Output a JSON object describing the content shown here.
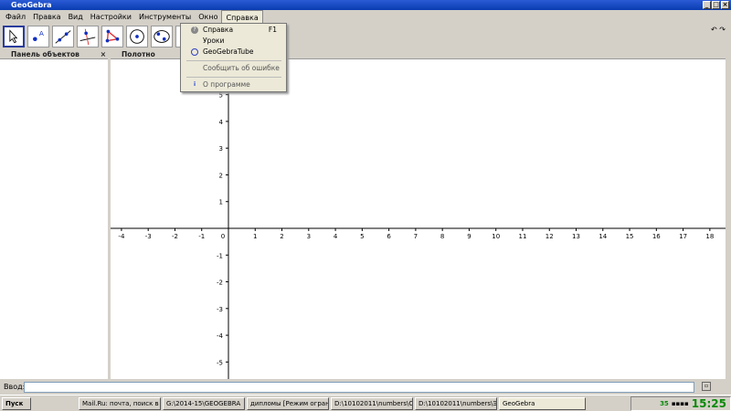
{
  "window": {
    "title": "GeoGebra"
  },
  "menubar": [
    "Файл",
    "Правка",
    "Вид",
    "Настройки",
    "Инструменты",
    "Окно",
    "Справка"
  ],
  "help_menu": {
    "items": [
      {
        "label": "Справка",
        "shortcut": "F1",
        "icon": "help-icon"
      },
      {
        "label": "Уроки"
      },
      {
        "label": "GeoGebraTube",
        "icon": "geogebra-icon"
      },
      {
        "label": "Сообщить об ошибке"
      },
      {
        "label": "О программе",
        "icon": "info-icon"
      }
    ]
  },
  "panels": {
    "algebra": "Панель объектов",
    "graphics": "Полотно"
  },
  "axes": {
    "x_ticks": [
      -4,
      -3,
      -2,
      -1,
      0,
      1,
      2,
      3,
      4,
      5,
      6,
      7,
      8,
      9,
      10,
      11,
      12,
      13,
      14,
      15,
      16,
      17,
      18
    ],
    "y_ticks": [
      5,
      4,
      3,
      2,
      1,
      -1,
      -2,
      -3,
      -4,
      -5
    ]
  },
  "input": {
    "label": "Ввод:",
    "value": ""
  },
  "taskbar": {
    "start": "Пуск",
    "tasks": [
      "Mail.Ru: почта, поиск в ...",
      "G:\\2014-15\\GEOGEBRA",
      "дипломы [Режим огран...",
      "D:\\10102011\\numbers\\C...",
      "D:\\10102011\\numbers\\Э...",
      "GeoGebra"
    ],
    "tray_num": "35",
    "clock": "15:25"
  }
}
